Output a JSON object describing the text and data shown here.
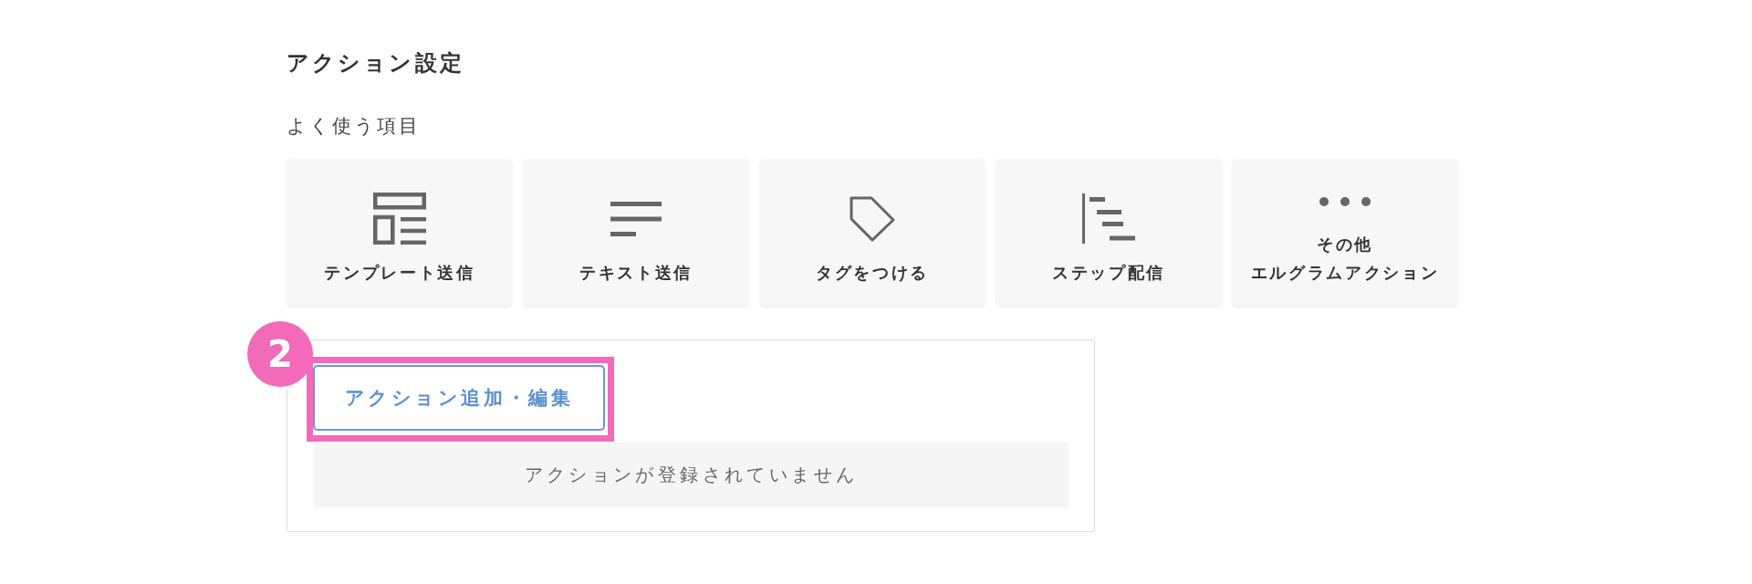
{
  "section": {
    "title": "アクション設定",
    "subtitle": "よく使う項目"
  },
  "quick_actions": [
    {
      "kind": "template",
      "label_lines": [
        "テンプレート送信"
      ]
    },
    {
      "kind": "text",
      "label_lines": [
        "テキスト送信"
      ]
    },
    {
      "kind": "tag",
      "label_lines": [
        "タグをつける"
      ]
    },
    {
      "kind": "step",
      "label_lines": [
        "ステップ配信"
      ]
    },
    {
      "kind": "more",
      "label_lines": [
        "その他",
        "エルグラムアクション"
      ]
    }
  ],
  "actions_panel": {
    "button": "アクション追加・編集",
    "empty_message": "アクションが登録されていません"
  },
  "annotation": {
    "badge": "2",
    "highlighted": true
  }
}
